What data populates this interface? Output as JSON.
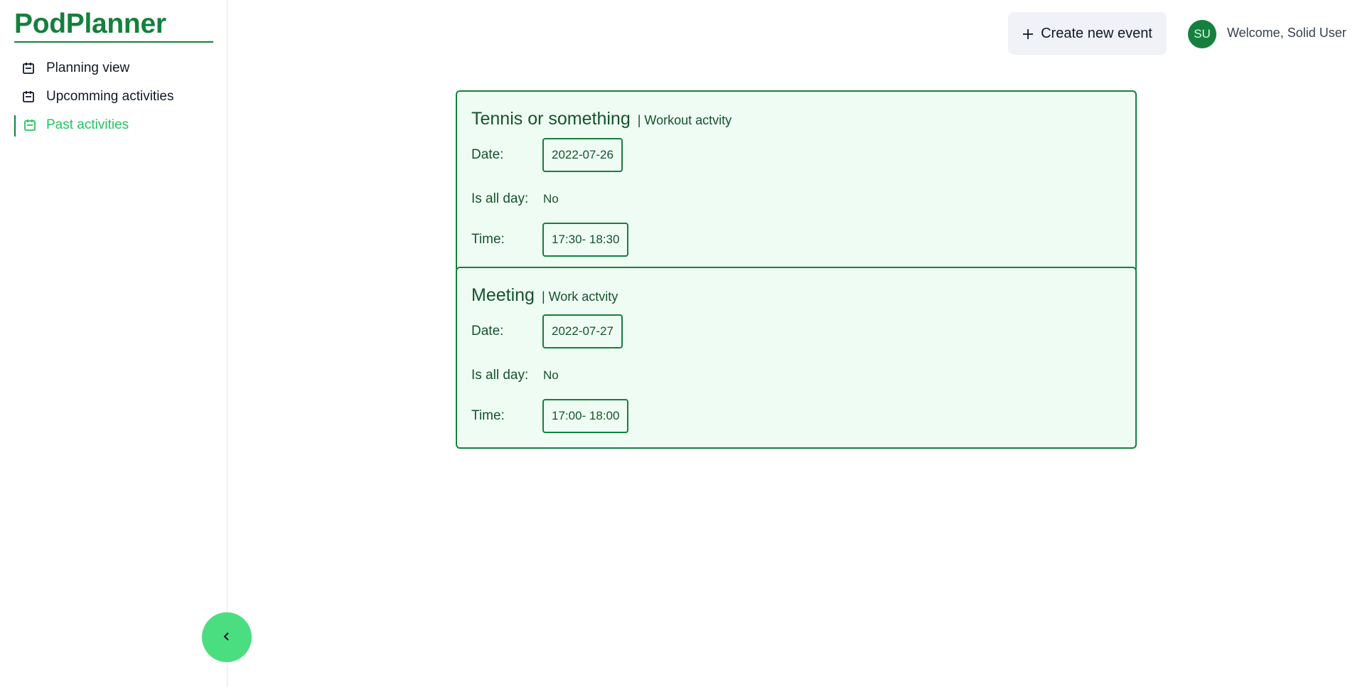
{
  "app": {
    "title": "PodPlanner"
  },
  "sidebar": {
    "items": [
      {
        "label": "Planning view",
        "icon": "calendar-icon",
        "active": false
      },
      {
        "label": "Upcomming activities",
        "icon": "calendar-icon",
        "active": false
      },
      {
        "label": "Past activities",
        "icon": "calendar-icon",
        "active": true
      }
    ],
    "collapse_icon": "chevron-left-icon"
  },
  "header": {
    "create_button_label": "Create new event",
    "create_button_icon": "plus-icon",
    "avatar_initials": "SU",
    "welcome_text": "Welcome, Solid User"
  },
  "labels": {
    "date": "Date:",
    "all_day": "Is all day:",
    "time": "Time:"
  },
  "events": [
    {
      "title": "Tennis or something",
      "category": "| Workout actvity",
      "date": "2022-07-26",
      "is_all_day": "No",
      "time": "17:30- 18:30"
    },
    {
      "title": "Meeting",
      "category": "| Work actvity",
      "date": "2022-07-27",
      "is_all_day": "No",
      "time": "17:00- 18:00"
    }
  ],
  "colors": {
    "brand": "#15803d",
    "active_nav": "#22c55e",
    "collapse_button": "#4ade80",
    "card_background": "#effcf3",
    "card_text": "#14532d"
  }
}
